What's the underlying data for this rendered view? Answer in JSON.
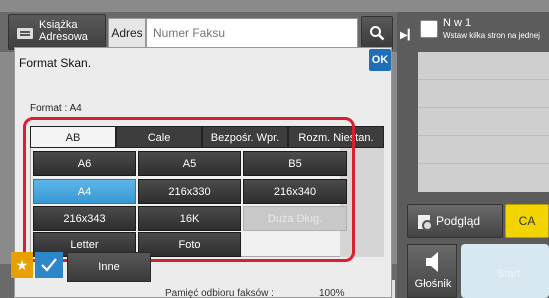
{
  "header": {
    "address_book_label": "Książka Adresowa",
    "address_label": "Adres",
    "fax_placeholder": "Numer Faksu"
  },
  "right": {
    "nw1_title": "N w 1",
    "nw1_subtitle": "Wstaw kilka stron na jednej",
    "preview_label": "Podgląd",
    "ca_label": "CA",
    "speaker_label": "Głośnik",
    "start_label": "Start"
  },
  "dialog": {
    "title": "Format Skan.",
    "ok_label": "OK",
    "format_label": "Format : A4",
    "tabs": [
      "AB",
      "Cale",
      "Bezpośr. Wpr.",
      "Rozm. Niestan."
    ],
    "active_tab": "AB",
    "sizes": [
      "A6",
      "A5",
      "B5",
      "A4",
      "216x330",
      "216x340",
      "216x343",
      "16K",
      "Duża Dług.",
      "Letter",
      "Foto"
    ],
    "selected_size": "A4",
    "disabled_size": "Duża Dług."
  },
  "bottom": {
    "other_label": "Inne",
    "memory_label": "Pamięć odbioru faksów :",
    "memory_value": "100%"
  },
  "colors": {
    "selected": "#3898d2",
    "highlight": "#d92033",
    "ok": "#1e6fb8",
    "ca": "#f2d400",
    "star": "#e8a000"
  }
}
